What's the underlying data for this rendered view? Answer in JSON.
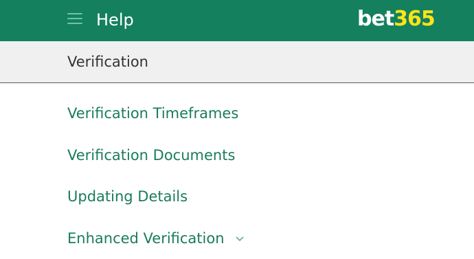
{
  "header": {
    "title": "Help",
    "logo": {
      "part1": "bet",
      "part2": "365"
    },
    "menu_icon": "hamburger-menu-icon"
  },
  "subheader": {
    "title": "Verification"
  },
  "links": [
    {
      "label": "Verification Timeframes"
    },
    {
      "label": "Verification Documents"
    },
    {
      "label": "Updating Details"
    },
    {
      "label": "Enhanced Verification",
      "icon": "chevron-down-icon"
    }
  ],
  "colors": {
    "header_bg": "#14805e",
    "link": "#1a7c5b",
    "logo_accent": "#ffe418",
    "subheader_bg": "#f0f0f0"
  }
}
